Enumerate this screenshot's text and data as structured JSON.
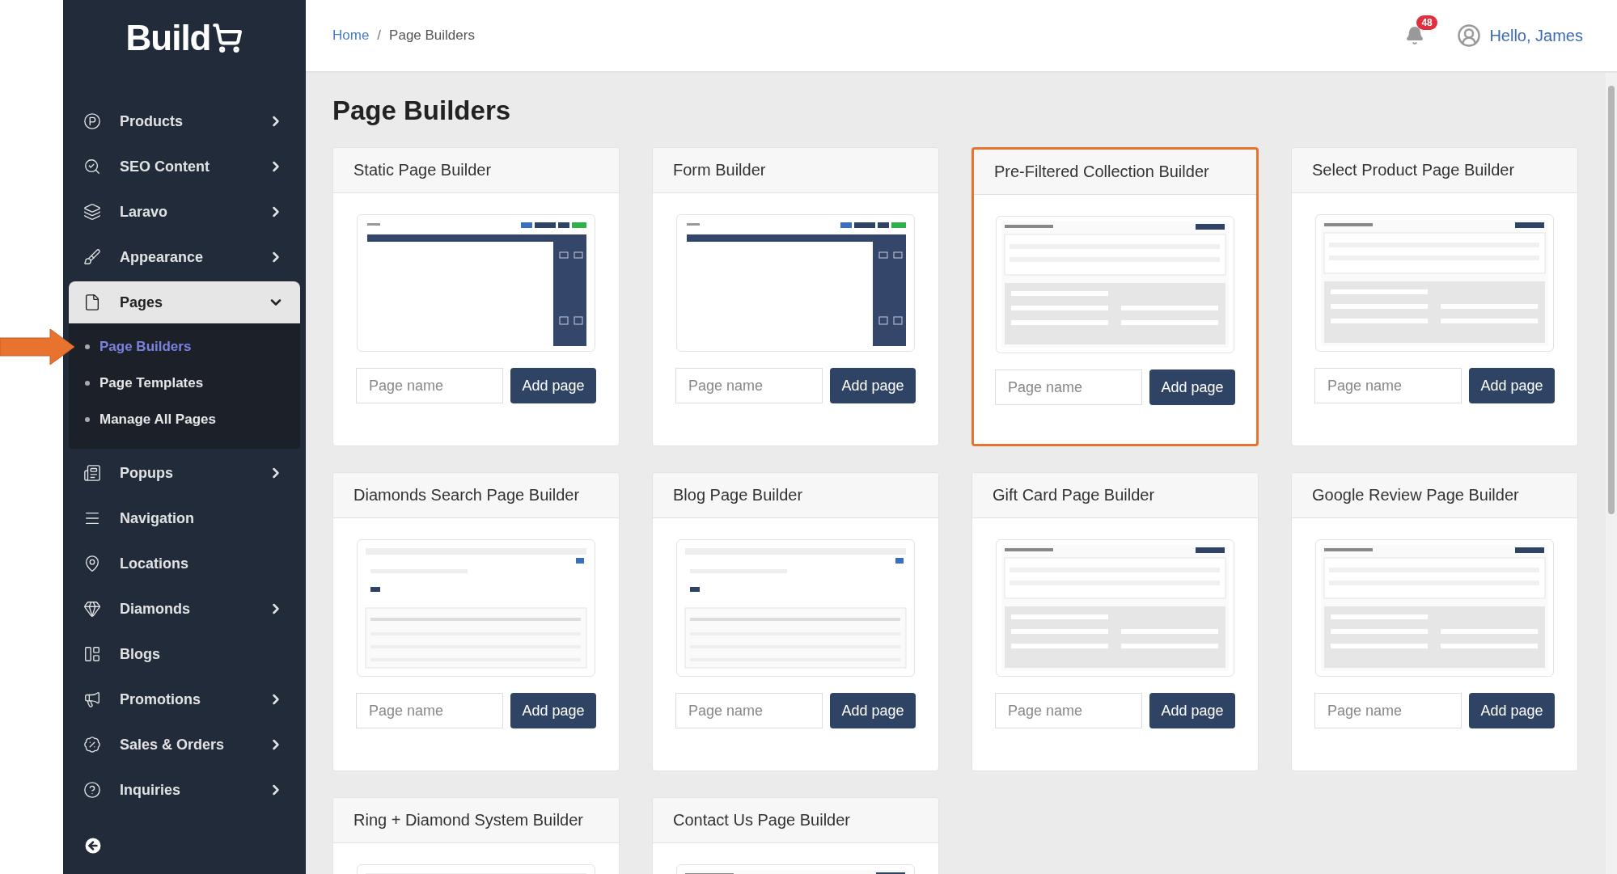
{
  "sidebar": {
    "logo": "Build",
    "items": [
      {
        "label": "Products",
        "expandable": true,
        "expanded": false
      },
      {
        "label": "SEO Content",
        "expandable": true,
        "expanded": false
      },
      {
        "label": "Laravo",
        "expandable": true,
        "expanded": false
      },
      {
        "label": "Appearance",
        "expandable": true,
        "expanded": false
      },
      {
        "label": "Pages",
        "expandable": true,
        "expanded": true,
        "children": [
          {
            "label": "Page Builders",
            "selected": true,
            "pointed_at": true
          },
          {
            "label": "Page Templates",
            "selected": false,
            "pointed_at": false
          },
          {
            "label": "Manage All Pages",
            "selected": false,
            "pointed_at": false
          }
        ]
      },
      {
        "label": "Popups",
        "expandable": true,
        "expanded": false
      },
      {
        "label": "Navigation",
        "expandable": false,
        "expanded": false
      },
      {
        "label": "Locations",
        "expandable": false,
        "expanded": false
      },
      {
        "label": "Diamonds",
        "expandable": true,
        "expanded": false
      },
      {
        "label": "Blogs",
        "expandable": false,
        "expanded": false
      },
      {
        "label": "Promotions",
        "expandable": true,
        "expanded": false
      },
      {
        "label": "Sales & Orders",
        "expandable": true,
        "expanded": false
      },
      {
        "label": "Inquiries",
        "expandable": true,
        "expanded": false
      }
    ]
  },
  "breadcrumb": {
    "separator": "/",
    "items": [
      {
        "label": "Home",
        "kind": "link"
      },
      {
        "label": "Page Builders",
        "kind": "current"
      }
    ]
  },
  "header": {
    "notifications": "48",
    "greeting": "Hello, James"
  },
  "page_title": "Page Builders",
  "builders": [
    {
      "title": "Static Page Builder",
      "placeholder": "Page name",
      "button": "Add page",
      "highlighted": false
    },
    {
      "title": "Form Builder",
      "placeholder": "Page name",
      "button": "Add page",
      "highlighted": false
    },
    {
      "title": "Pre-Filtered Collection Builder",
      "placeholder": "Page name",
      "button": "Add page",
      "highlighted": true
    },
    {
      "title": "Select Product Page Builder",
      "placeholder": "Page name",
      "button": "Add page",
      "highlighted": false
    },
    {
      "title": "Diamonds Search Page Builder",
      "placeholder": "Page name",
      "button": "Add page",
      "highlighted": false
    },
    {
      "title": "Blog Page Builder",
      "placeholder": "Page name",
      "button": "Add page",
      "highlighted": false
    },
    {
      "title": "Gift Card Page Builder",
      "placeholder": "Page name",
      "button": "Add page",
      "highlighted": false
    },
    {
      "title": "Google Review Page Builder",
      "placeholder": "Page name",
      "button": "Add page",
      "highlighted": false
    },
    {
      "title": "Ring + Diamond System Builder",
      "highlighted": false
    },
    {
      "title": "Contact Us Page Builder",
      "highlighted": false
    }
  ]
}
